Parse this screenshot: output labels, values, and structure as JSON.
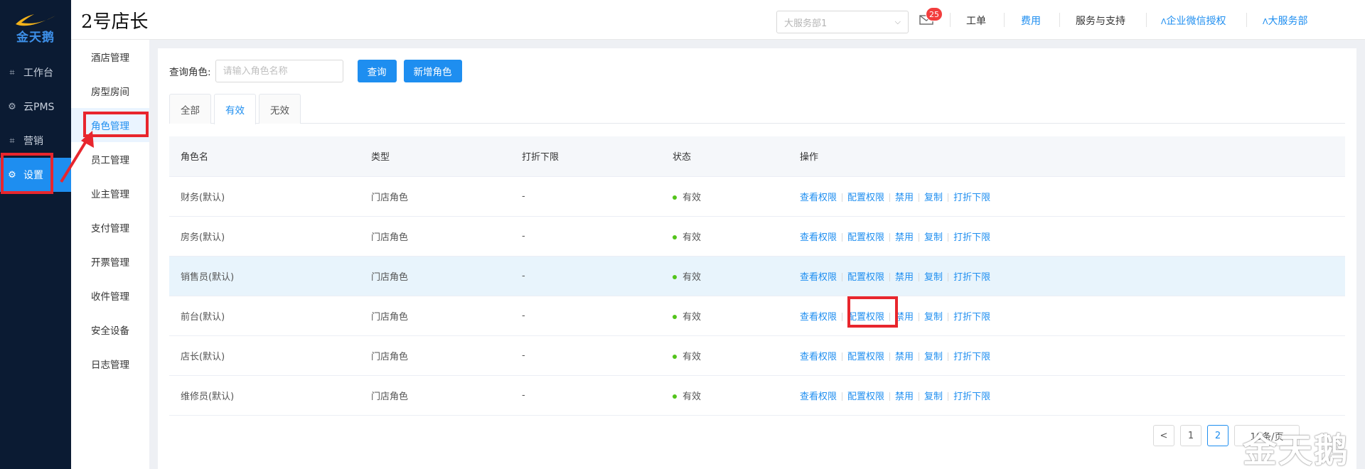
{
  "logo": {
    "text": "金天鹅"
  },
  "sidebar": {
    "items": [
      {
        "label": "工作台",
        "icon": "dashboard-icon"
      },
      {
        "label": "云PMS",
        "icon": "gear-icon"
      },
      {
        "label": "营销",
        "icon": "marketing-icon"
      },
      {
        "label": "设置",
        "icon": "settings-icon",
        "active": true
      }
    ]
  },
  "header": {
    "title": "2号店长",
    "store_select": {
      "value": "大服务部1"
    },
    "mail_badge": "25",
    "links": {
      "work_order": "工单",
      "fees": "费用",
      "support": "服务与支持",
      "wechat_auth": "企业微信授权",
      "user": "大服务部"
    }
  },
  "subnav": {
    "items": [
      {
        "label": "酒店管理"
      },
      {
        "label": "房型房间"
      },
      {
        "label": "角色管理",
        "active": true
      },
      {
        "label": "员工管理"
      },
      {
        "label": "业主管理"
      },
      {
        "label": "支付管理"
      },
      {
        "label": "开票管理"
      },
      {
        "label": "收件管理"
      },
      {
        "label": "安全设备"
      },
      {
        "label": "日志管理"
      }
    ]
  },
  "search": {
    "label": "查询角色:",
    "placeholder": "请输入角色名称",
    "query_button": "查询",
    "add_button": "新增角色"
  },
  "tabs": [
    {
      "label": "全部"
    },
    {
      "label": "有效",
      "active": true
    },
    {
      "label": "无效"
    }
  ],
  "table": {
    "columns": [
      "角色名",
      "类型",
      "打折下限",
      "状态",
      "操作"
    ],
    "actions": [
      "查看权限",
      "配置权限",
      "禁用",
      "复制",
      "打折下限"
    ],
    "rows": [
      {
        "name": "财务(默认)",
        "type": "门店角色",
        "discount": "-",
        "status": "有效"
      },
      {
        "name": "房务(默认)",
        "type": "门店角色",
        "discount": "-",
        "status": "有效"
      },
      {
        "name": "销售员(默认)",
        "type": "门店角色",
        "discount": "-",
        "status": "有效"
      },
      {
        "name": "前台(默认)",
        "type": "门店角色",
        "discount": "-",
        "status": "有效"
      },
      {
        "name": "店长(默认)",
        "type": "门店角色",
        "discount": "-",
        "status": "有效"
      },
      {
        "name": "维修员(默认)",
        "type": "门店角色",
        "discount": "-",
        "status": "有效"
      }
    ]
  },
  "pagination": {
    "prev": "<",
    "pages": [
      "1",
      "2"
    ],
    "current": "2",
    "page_size": "10条/页"
  },
  "watermark": "金天鹅",
  "colors": {
    "accent": "#1e8ef0",
    "sidebar": "#0b1b33",
    "annotation": "#e8262d",
    "status_ok": "#52c41a"
  }
}
